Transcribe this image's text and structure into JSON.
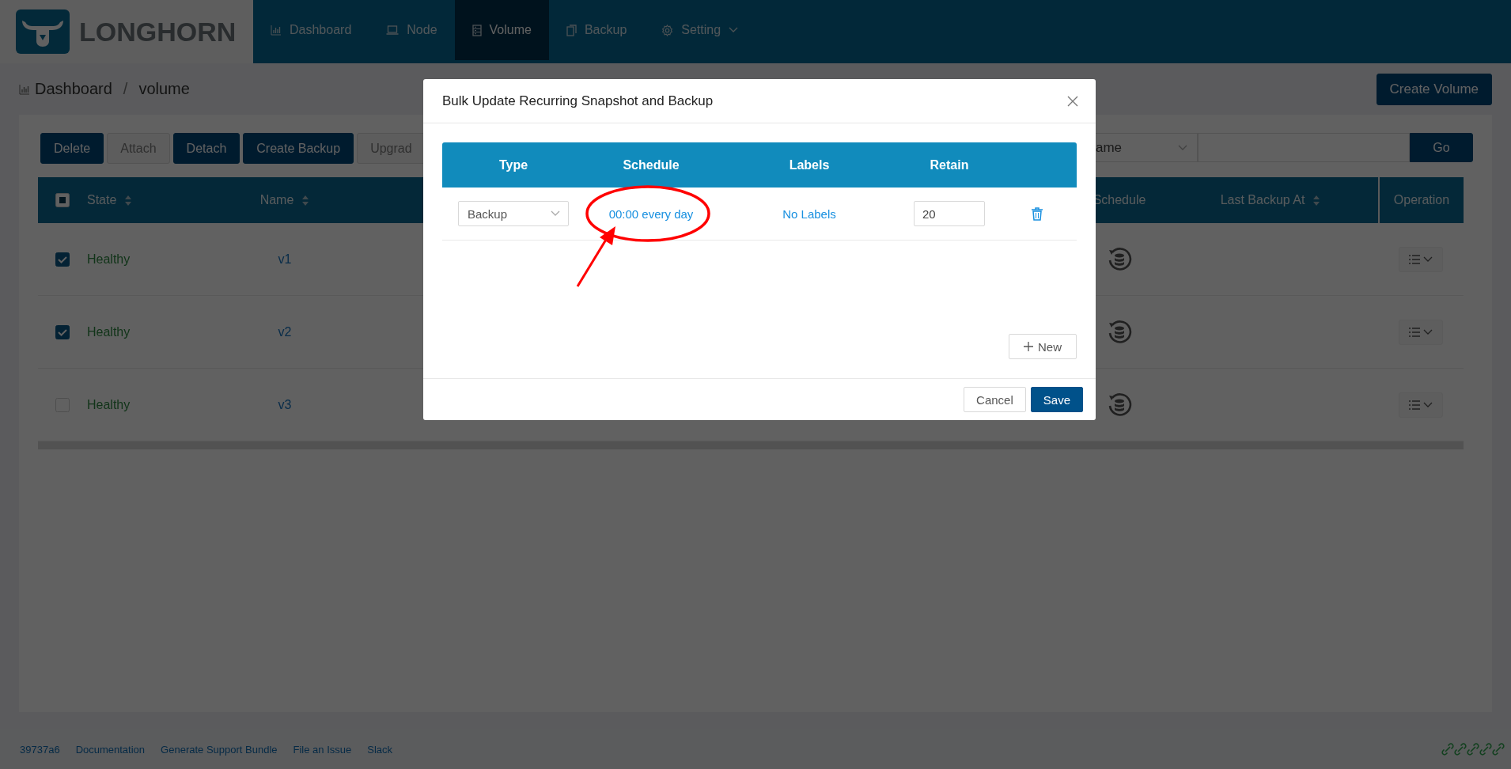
{
  "header": {
    "logo_text": "LONGHORN",
    "nav": [
      {
        "label": "Dashboard",
        "kind": "dashboard",
        "selected": false,
        "dropdown": false
      },
      {
        "label": "Node",
        "kind": "node",
        "selected": false,
        "dropdown": false
      },
      {
        "label": "Volume",
        "kind": "volume",
        "selected": true,
        "dropdown": false
      },
      {
        "label": "Backup",
        "kind": "backup",
        "selected": false,
        "dropdown": false
      },
      {
        "label": "Setting",
        "kind": "setting",
        "selected": false,
        "dropdown": true
      }
    ]
  },
  "breadcrumb": {
    "link": "Dashboard",
    "separator": "/",
    "current": "volume"
  },
  "create_button": "Create Volume",
  "toolbar": {
    "buttons": [
      {
        "label": "Delete",
        "disabled": false
      },
      {
        "label": "Attach",
        "disabled": true
      },
      {
        "label": "Detach",
        "disabled": false
      },
      {
        "label": "Create Backup",
        "disabled": false
      },
      {
        "label": "Upgrad",
        "disabled": true
      }
    ],
    "filter_select": "ame",
    "go_button": "Go"
  },
  "table": {
    "select_all_partial": true,
    "columns": [
      {
        "label": "State",
        "sortable": true
      },
      {
        "label": "Name",
        "sortable": true
      },
      {
        "label": "Schedule",
        "sortable": false
      },
      {
        "label": "Last Backup At",
        "sortable": true
      },
      {
        "label": "Operation",
        "sortable": false
      }
    ],
    "rows": [
      {
        "checked": true,
        "state": "Healthy",
        "name": "v1"
      },
      {
        "checked": true,
        "state": "Healthy",
        "name": "v2"
      },
      {
        "checked": false,
        "state": "Healthy",
        "name": "v3"
      }
    ]
  },
  "modal": {
    "title": "Bulk Update Recurring Snapshot and Backup",
    "columns": [
      "Type",
      "Schedule",
      "Labels",
      "Retain"
    ],
    "jobs": [
      {
        "type": "Backup",
        "schedule": "00:00 every day",
        "labels": "No Labels",
        "retain": "20"
      }
    ],
    "new_button": "New",
    "buttons": [
      {
        "label": "Cancel",
        "kind": "default"
      },
      {
        "label": "Save",
        "kind": "primary"
      }
    ]
  },
  "footer": {
    "links": [
      "39737a6",
      "Documentation",
      "Generate Support Bundle",
      "File an Issue",
      "Slack"
    ]
  }
}
